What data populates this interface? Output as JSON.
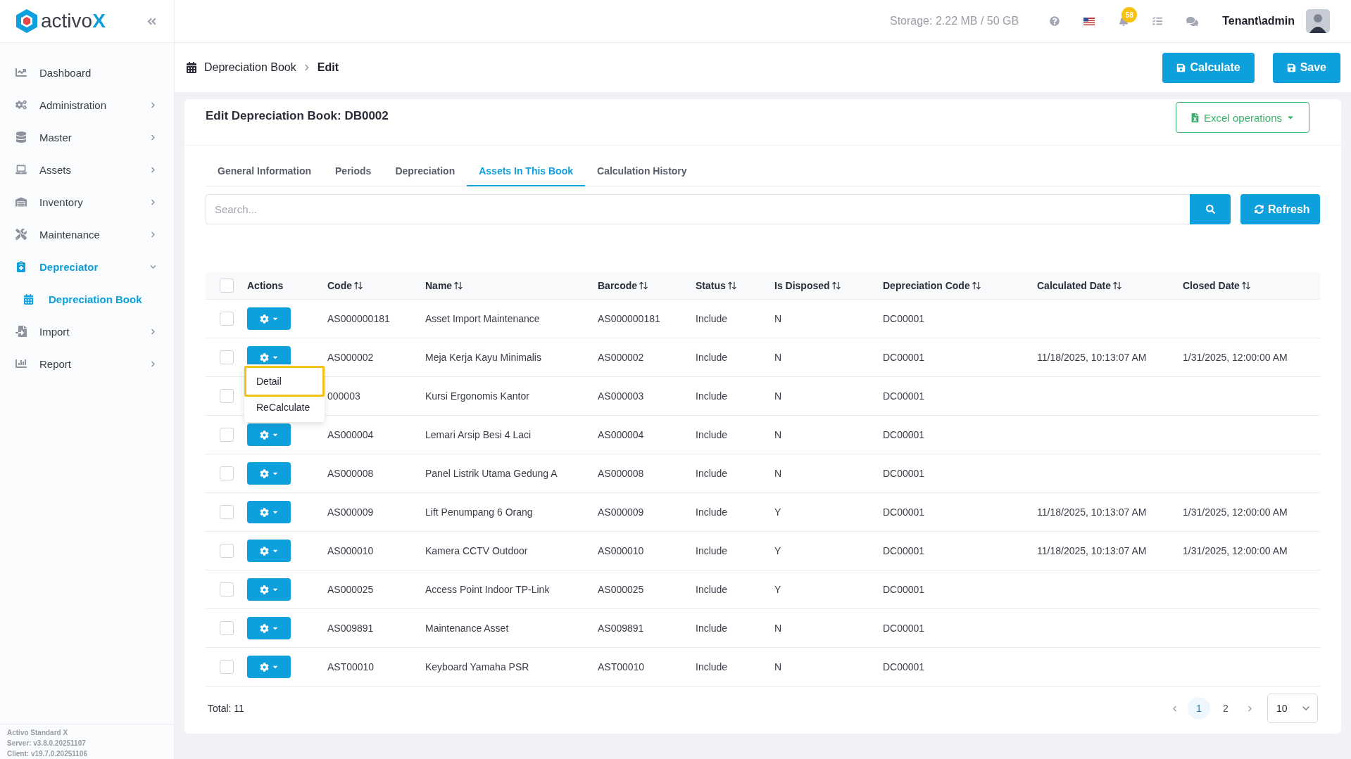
{
  "sidebar": {
    "logo": {
      "text": "activo",
      "accent": "X"
    },
    "items": [
      {
        "label": "Dashboard",
        "has_submenu": false,
        "selected": false
      },
      {
        "label": "Administration",
        "has_submenu": true,
        "expanded": false,
        "selected": false
      },
      {
        "label": "Master",
        "has_submenu": true,
        "expanded": false,
        "selected": false
      },
      {
        "label": "Assets",
        "has_submenu": true,
        "expanded": false,
        "selected": false
      },
      {
        "label": "Inventory",
        "has_submenu": true,
        "expanded": false,
        "selected": false
      },
      {
        "label": "Maintenance",
        "has_submenu": true,
        "expanded": false,
        "selected": false
      },
      {
        "label": "Depreciator",
        "has_submenu": true,
        "expanded": true,
        "selected": true,
        "children": [
          {
            "label": "Depreciation Book",
            "selected": true
          }
        ]
      },
      {
        "label": "Import",
        "has_submenu": true,
        "expanded": false,
        "selected": false
      },
      {
        "label": "Report",
        "has_submenu": true,
        "expanded": false,
        "selected": false
      }
    ],
    "footer": [
      "Activo Standard X",
      "Server: v3.8.0.20251107",
      "Client: v19.7.0.20251106"
    ]
  },
  "header": {
    "storage": "Storage: 2.22 MB / 50 GB",
    "notification_count": "58",
    "user": "Tenant\\admin"
  },
  "breadcrumb": [
    "Depreciation Book",
    "Edit"
  ],
  "actions": [
    "Calculate",
    "Save"
  ],
  "card": {
    "title": "Edit Depreciation Book: DB0002",
    "excel_button": "Excel operations",
    "tabs": [
      {
        "label": "General Information",
        "selected": false
      },
      {
        "label": "Periods",
        "selected": false
      },
      {
        "label": "Depreciation",
        "selected": false
      },
      {
        "label": "Assets In This Book",
        "selected": true
      },
      {
        "label": "Calculation History",
        "selected": false
      }
    ],
    "search": {
      "placeholder": "Search..."
    },
    "refresh_button": "Refresh",
    "table": {
      "columns": [
        {
          "kind": "checkbox",
          "checked": false
        },
        {
          "kind": "text",
          "label": "Actions",
          "sortable": false
        },
        {
          "kind": "text",
          "label": "Code",
          "sortable": true
        },
        {
          "kind": "text",
          "label": "Name",
          "sortable": true
        },
        {
          "kind": "text",
          "label": "Barcode",
          "sortable": true
        },
        {
          "kind": "text",
          "label": "Status",
          "sortable": true
        },
        {
          "kind": "text",
          "label": "Is Disposed",
          "sortable": true
        },
        {
          "kind": "text",
          "label": "Depreciation Code",
          "sortable": true
        },
        {
          "kind": "text",
          "label": "Calculated Date",
          "sortable": true
        },
        {
          "kind": "text",
          "label": "Closed Date",
          "sortable": true
        }
      ],
      "rows": [
        {
          "checked": false,
          "cells": [
            "",
            "",
            "AS000000181",
            "Asset Import Maintenance",
            "AS000000181",
            "Include",
            "N",
            "DC00001",
            "",
            ""
          ]
        },
        {
          "checked": false,
          "cells": [
            "",
            "",
            "AS000002",
            "Meja Kerja Kayu Minimalis",
            "AS000002",
            "Include",
            "N",
            "DC00001",
            "11/18/2025, 10:13:07 AM",
            "1/31/2025, 12:00:00 AM"
          ],
          "menu": [
            {
              "label": "Detail",
              "highlighted": true
            },
            {
              "label": "ReCalculate",
              "highlighted": false
            }
          ]
        },
        {
          "checked": false,
          "action_button": false,
          "cells": [
            "",
            "",
            "000003",
            "Kursi Ergonomis Kantor",
            "AS000003",
            "Include",
            "N",
            "DC00001",
            "",
            ""
          ]
        },
        {
          "checked": false,
          "cells": [
            "",
            "",
            "AS000004",
            "Lemari Arsip Besi 4 Laci",
            "AS000004",
            "Include",
            "N",
            "DC00001",
            "",
            ""
          ]
        },
        {
          "checked": false,
          "cells": [
            "",
            "",
            "AS000008",
            "Panel Listrik Utama Gedung A",
            "AS000008",
            "Include",
            "N",
            "DC00001",
            "",
            ""
          ]
        },
        {
          "checked": false,
          "cells": [
            "",
            "",
            "AS000009",
            "Lift Penumpang 6 Orang",
            "AS000009",
            "Include",
            "Y",
            "DC00001",
            "11/18/2025, 10:13:07 AM",
            "1/31/2025, 12:00:00 AM"
          ]
        },
        {
          "checked": false,
          "cells": [
            "",
            "",
            "AS000010",
            "Kamera CCTV Outdoor",
            "AS000010",
            "Include",
            "Y",
            "DC00001",
            "11/18/2025, 10:13:07 AM",
            "1/31/2025, 12:00:00 AM"
          ]
        },
        {
          "checked": false,
          "cells": [
            "",
            "",
            "AS000025",
            "Access Point Indoor TP-Link",
            "AS000025",
            "Include",
            "Y",
            "DC00001",
            "",
            ""
          ]
        },
        {
          "checked": false,
          "cells": [
            "",
            "",
            "AS009891",
            "Maintenance Asset",
            "AS009891",
            "Include",
            "N",
            "DC00001",
            "",
            ""
          ]
        },
        {
          "checked": false,
          "cells": [
            "",
            "",
            "AST00010",
            "Keyboard Yamaha PSR",
            "AST00010",
            "Include",
            "N",
            "DC00001",
            "",
            ""
          ]
        }
      ]
    },
    "total": "Total: 11",
    "pagination": {
      "pages": [
        {
          "label": "1",
          "selected": true
        },
        {
          "label": "2",
          "selected": false
        }
      ],
      "page_size": "10"
    }
  }
}
